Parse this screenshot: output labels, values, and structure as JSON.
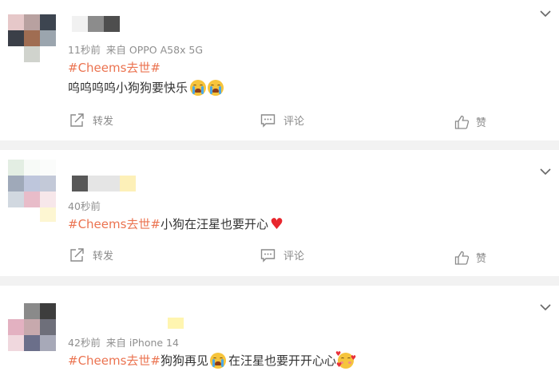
{
  "posts": [
    {
      "meta_time": "11秒前",
      "meta_source": "来自 OPPO A58x 5G",
      "tag": "#Cheems去世#",
      "text": "呜呜呜呜小狗狗要快乐",
      "emojis": [
        "crying-face-icon",
        "crying-face-icon"
      ],
      "actions": {
        "repost": "转发",
        "comment": "评论",
        "like": "赞"
      }
    },
    {
      "meta_time": "40秒前",
      "tag": "#Cheems去世#",
      "text": "小狗在汪星也要开心",
      "emojis": [
        "red-heart-icon"
      ],
      "actions": {
        "repost": "转发",
        "comment": "评论",
        "like": "赞"
      }
    },
    {
      "meta_time": "42秒前",
      "meta_source": "来自 iPhone 14",
      "tag": "#Cheems去世#",
      "text": "狗狗再见",
      "text2": "在汪星也要开开心心",
      "emojis": [
        "crying-face-icon",
        "smiling-face-with-hearts-icon"
      ]
    }
  ],
  "colors": {
    "topic_tag": "#eb7350",
    "meta_text": "#8f8f8f",
    "separator": "#f2f2f2",
    "action_text": "#8a8a8a"
  }
}
